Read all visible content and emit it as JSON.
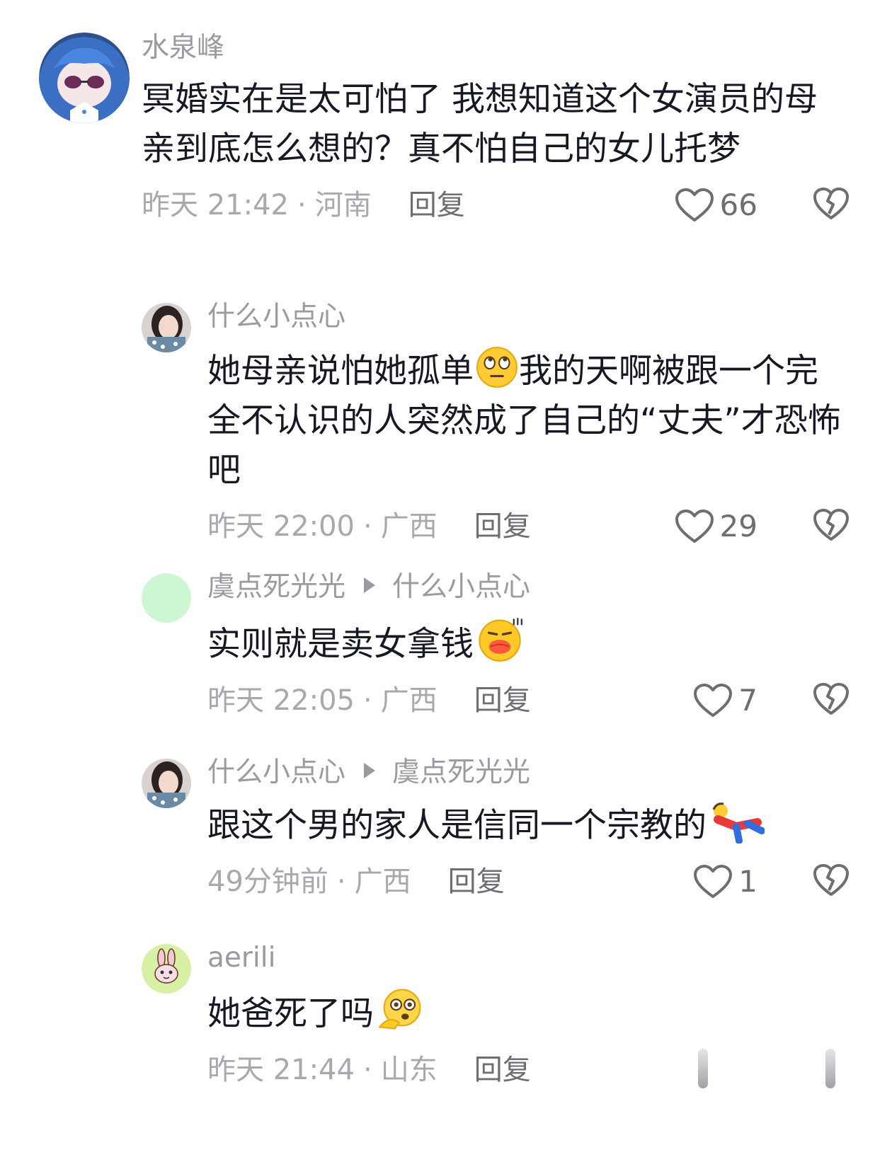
{
  "comments": [
    {
      "username": "水泉峰",
      "text": "冥婚实在是太可怕了 我想知道这个女演员的母亲到底怎么想的？真不怕自己的女儿托梦",
      "time": "昨天 21:42",
      "location": "河南",
      "reply_label": "回复",
      "likes": "66",
      "avatar_icon": "anime-girl-avatar-icon"
    },
    {
      "username": "什么小点心",
      "text": "她母亲说怕她孤单",
      "text_after_emoji": "我的天啊被跟一个完全不认识的人突然成了自己的“丈夫”才恐怖吧",
      "emoji": "eye-roll-emoji",
      "time": "昨天 22:00",
      "location": "广西",
      "reply_label": "回复",
      "likes": "29",
      "avatar_icon": "woman-photo-avatar-icon"
    },
    {
      "username": "虞点死光光",
      "reply_to": "什么小点心",
      "text": "实则就是卖女拿钱",
      "emoji": "pouting-lips-emoji",
      "time": "昨天 22:05",
      "location": "广西",
      "reply_label": "回复",
      "likes": "7",
      "avatar_icon": "green-circle-avatar-icon"
    },
    {
      "username": "什么小点心",
      "reply_to": "虞点死光光",
      "text": "跟这个男的家人是信同一个宗教的",
      "emoji": "fallen-person-emoji",
      "time": "49分钟前",
      "location": "广西",
      "reply_label": "回复",
      "likes": "1",
      "avatar_icon": "woman-photo-avatar-icon"
    },
    {
      "username": "aerili",
      "text": "她爸死了吗",
      "emoji": "thinking-face-emoji",
      "time": "昨天 21:44",
      "location": "山东",
      "reply_label": "回复",
      "avatar_icon": "bunny-avatar-icon"
    }
  ],
  "colors": {
    "name": "#9a9ba1",
    "text": "#161823",
    "meta": "#a8a9ae",
    "icon": "#6d6e74"
  }
}
